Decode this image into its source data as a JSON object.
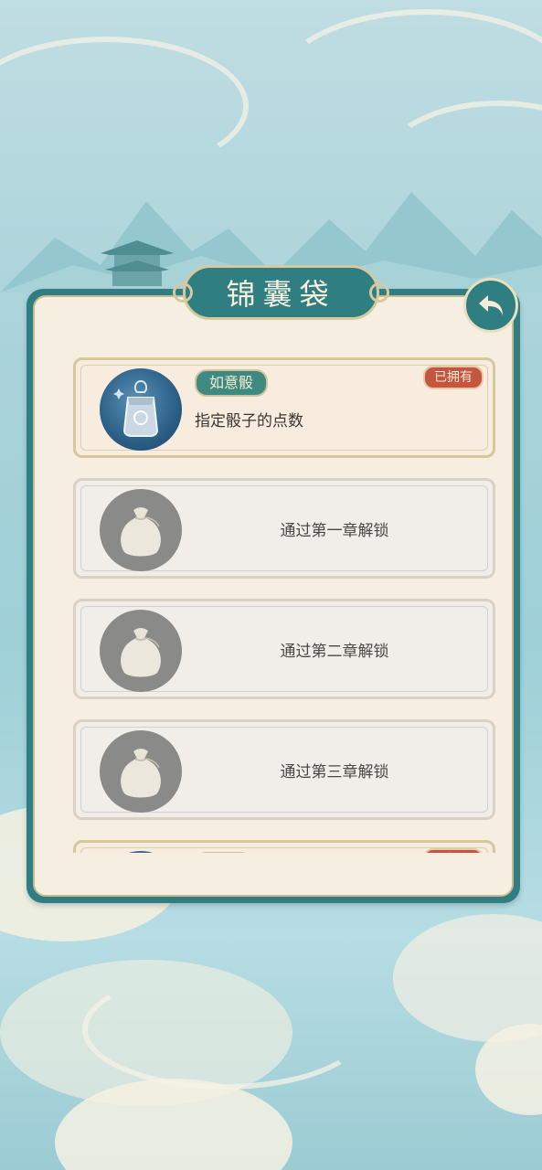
{
  "title": "锦囊袋",
  "back_button": {
    "icon": "back-arrow-icon"
  },
  "items": [
    {
      "status": "owned",
      "name": "如意骰",
      "badge": "已拥有",
      "description": "指定骰子的点数",
      "icon": "charm-pouch-icon"
    },
    {
      "status": "locked",
      "unlock_text": "通过第一章解锁",
      "icon": "bag-icon"
    },
    {
      "status": "locked",
      "unlock_text": "通过第二章解锁",
      "icon": "bag-icon"
    },
    {
      "status": "locked",
      "unlock_text": "通过第三章解锁",
      "icon": "bag-icon"
    },
    {
      "status": "owned",
      "name": "疾风",
      "badge": "已拥有",
      "icon": "charm-pouch-icon"
    }
  ]
}
